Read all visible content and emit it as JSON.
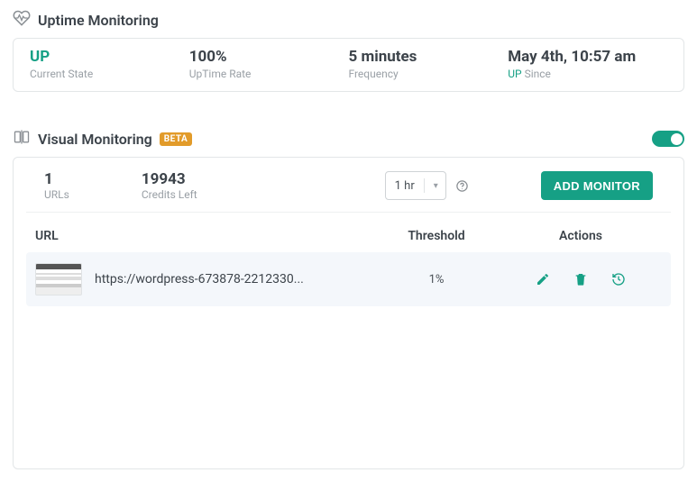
{
  "uptime": {
    "title": "Uptime Monitoring",
    "state_value": "UP",
    "state_label": "Current State",
    "rate_value": "100%",
    "rate_label": "UpTime Rate",
    "freq_value": "5 minutes",
    "freq_label": "Frequency",
    "since_value": "May 4th, 10:57 am",
    "since_prefix": "UP",
    "since_label": "Since"
  },
  "visual": {
    "title": "Visual Monitoring",
    "beta": "BETA",
    "toggle_on": true,
    "urls_value": "1",
    "urls_label": "URLs",
    "credits_value": "19943",
    "credits_label": "Credits Left",
    "interval_selected": "1 hr",
    "add_button": "ADD MONITOR",
    "columns": {
      "url": "URL",
      "threshold": "Threshold",
      "actions": "Actions"
    },
    "rows": [
      {
        "url": "https://wordpress-673878-2212330...",
        "threshold": "1%"
      }
    ]
  }
}
